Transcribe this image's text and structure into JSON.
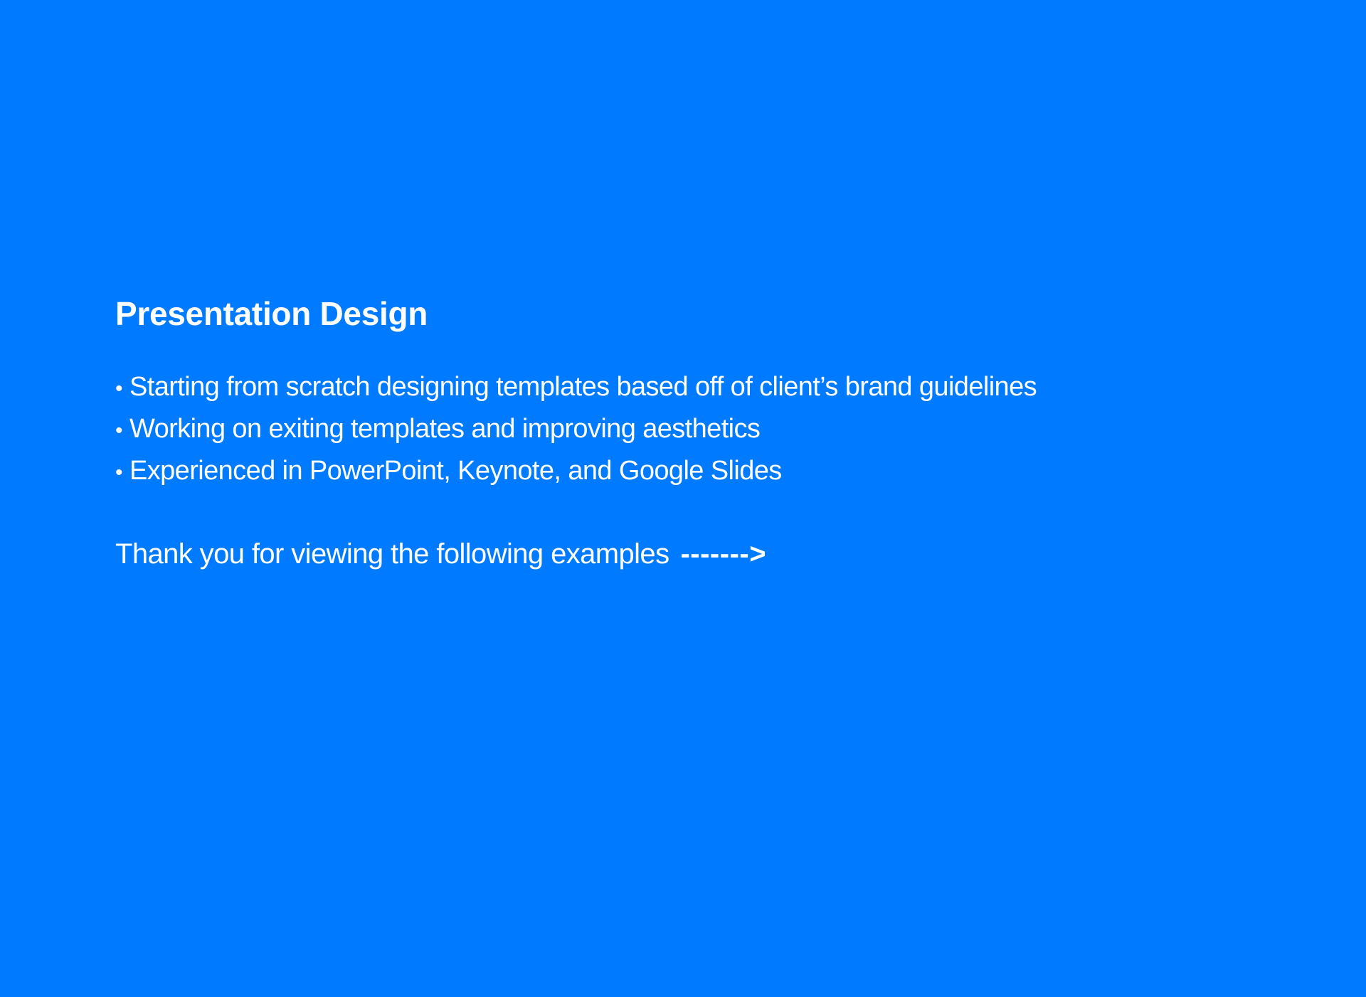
{
  "slide": {
    "background_color": "#007aff",
    "text_color": "#ffffff",
    "title": "Presentation Design",
    "bullet_marker": "•",
    "bullets": [
      "Starting from scratch designing templates based off of client’s brand guidelines",
      "Working on exiting templates and improving aesthetics",
      "Experienced in PowerPoint, Keynote, and Google Slides"
    ],
    "thanks_text": "Thank you for viewing the following examples",
    "arrow_text": "------->"
  }
}
